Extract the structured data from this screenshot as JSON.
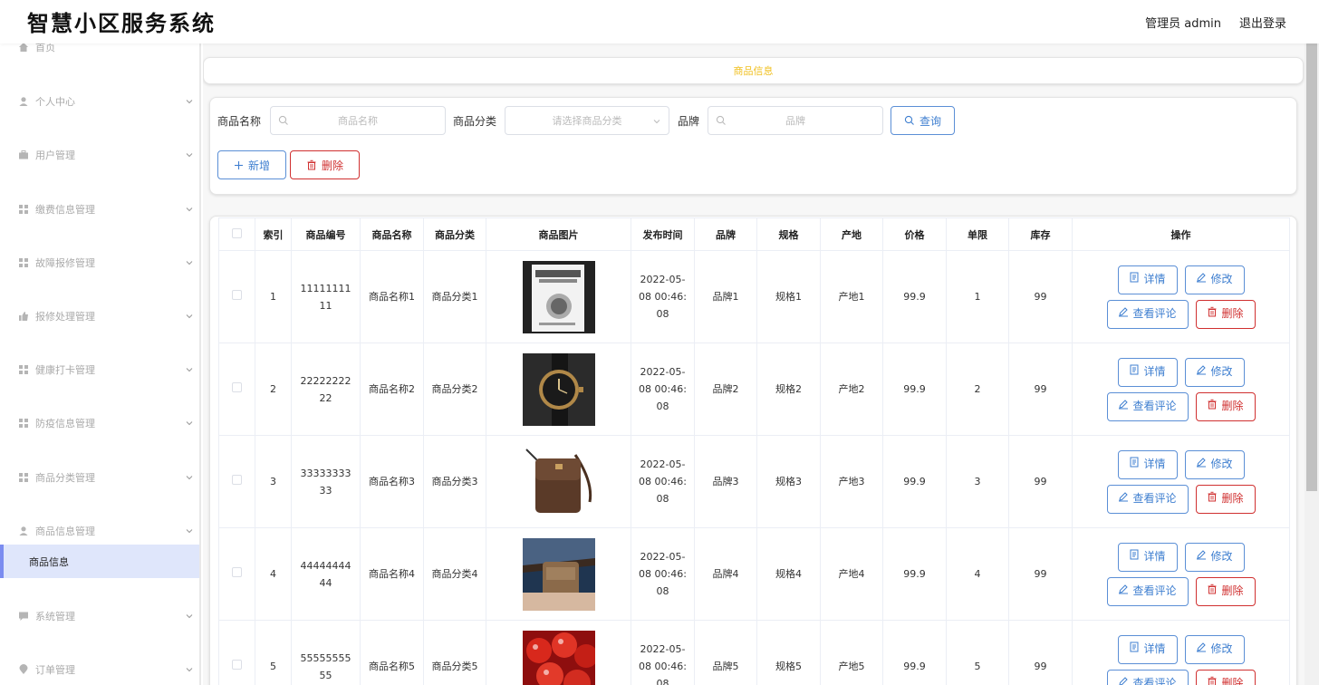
{
  "app": {
    "title": "智慧小区服务系统"
  },
  "header": {
    "user": "管理员 admin",
    "logout": "退出登录"
  },
  "sidebar": {
    "items": [
      {
        "label": "首页",
        "icon": "home-icon",
        "expandable": false
      },
      {
        "label": "个人中心",
        "icon": "user-icon",
        "expandable": true
      },
      {
        "label": "用户管理",
        "icon": "briefcase-icon",
        "expandable": true
      },
      {
        "label": "缴费信息管理",
        "icon": "grid-icon",
        "expandable": true
      },
      {
        "label": "故障报修管理",
        "icon": "grid-icon",
        "expandable": true
      },
      {
        "label": "报修处理管理",
        "icon": "thumb-icon",
        "expandable": true
      },
      {
        "label": "健康打卡管理",
        "icon": "grid-icon",
        "expandable": true
      },
      {
        "label": "防疫信息管理",
        "icon": "grid-icon",
        "expandable": true
      },
      {
        "label": "商品分类管理",
        "icon": "grid-icon",
        "expandable": true
      },
      {
        "label": "商品信息管理",
        "icon": "user-icon",
        "expandable": true
      },
      {
        "label": "系统管理",
        "icon": "chat-icon",
        "expandable": true
      },
      {
        "label": "订单管理",
        "icon": "location-icon",
        "expandable": true
      }
    ],
    "active_sub": "商品信息"
  },
  "breadcrumb": "商品信息",
  "search": {
    "name_label": "商品名称",
    "name_placeholder": "商品名称",
    "category_label": "商品分类",
    "category_placeholder": "请选择商品分类",
    "brand_label": "品牌",
    "brand_placeholder": "品牌",
    "query_button": "查询",
    "add_button": "新增",
    "delete_button": "删除"
  },
  "table": {
    "columns": [
      "索引",
      "商品编号",
      "商品名称",
      "商品分类",
      "商品图片",
      "发布时间",
      "品牌",
      "规格",
      "产地",
      "价格",
      "单限",
      "库存",
      "操作"
    ],
    "rows": [
      {
        "index": "1",
        "code": "1111111111",
        "name": "商品名称1",
        "category": "商品分类1",
        "image": "book",
        "time": "2022-05-08 00:46:08",
        "brand": "品牌1",
        "spec": "规格1",
        "origin": "产地1",
        "price": "99.9",
        "limit": "1",
        "stock": "99"
      },
      {
        "index": "2",
        "code": "2222222222",
        "name": "商品名称2",
        "category": "商品分类2",
        "image": "watch",
        "time": "2022-05-08 00:46:08",
        "brand": "品牌2",
        "spec": "规格2",
        "origin": "产地2",
        "price": "99.9",
        "limit": "2",
        "stock": "99"
      },
      {
        "index": "3",
        "code": "3333333333",
        "name": "商品名称3",
        "category": "商品分类3",
        "image": "bag",
        "time": "2022-05-08 00:46:08",
        "brand": "品牌3",
        "spec": "规格3",
        "origin": "产地3",
        "price": "99.9",
        "limit": "3",
        "stock": "99"
      },
      {
        "index": "4",
        "code": "4444444444",
        "name": "商品名称4",
        "category": "商品分类4",
        "image": "waistbag",
        "time": "2022-05-08 00:46:08",
        "brand": "品牌4",
        "spec": "规格4",
        "origin": "产地4",
        "price": "99.9",
        "limit": "4",
        "stock": "99"
      },
      {
        "index": "5",
        "code": "5555555555",
        "name": "商品名称5",
        "category": "商品分类5",
        "image": "cherries",
        "time": "2022-05-08 00:46:08",
        "brand": "品牌5",
        "spec": "规格5",
        "origin": "产地5",
        "price": "99.9",
        "limit": "5",
        "stock": "99"
      }
    ],
    "actions": {
      "detail": "详情",
      "edit": "修改",
      "comments": "查看评论",
      "delete": "删除"
    }
  },
  "colors": {
    "accent": "#3f7fd0",
    "danger": "#d03030",
    "breadcrumb": "#f0c020",
    "active_bg": "#dfe6fb"
  }
}
